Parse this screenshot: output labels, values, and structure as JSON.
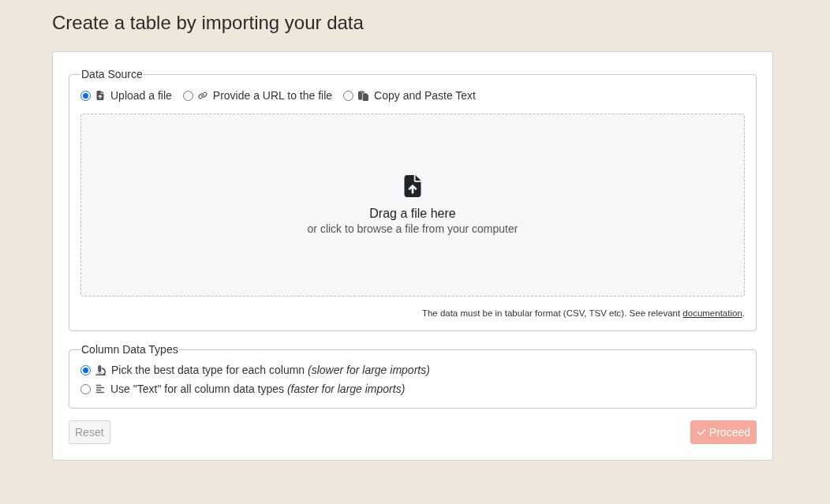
{
  "page": {
    "title": "Create a table by importing your data"
  },
  "data_source": {
    "legend": "Data Source",
    "options": [
      {
        "kind": "file",
        "label": "Upload a file",
        "selected": true
      },
      {
        "kind": "url",
        "label": "Provide a URL to the file",
        "selected": false
      },
      {
        "kind": "paste",
        "label": "Copy and Paste Text",
        "selected": false
      }
    ],
    "dropzone": {
      "title": "Drag a file here",
      "subtitle": "or click to browse a file from your computer"
    },
    "note": {
      "text": "The data must be in tabular format (CSV, TSV etc). See relevant ",
      "link": "documentation",
      "end": "."
    }
  },
  "column_types": {
    "legend": "Column Data Types",
    "options": [
      {
        "kind": "auto",
        "label": "Pick the best data type for each column *(slower for large imports)*",
        "selected": true
      },
      {
        "kind": "text",
        "label": "Use \"Text\" for all column data types *(faster for large imports)*",
        "selected": false
      }
    ]
  },
  "buttons": [
    {
      "kind": "secondary",
      "label": "Reset",
      "disabled": true
    },
    {
      "kind": "primary",
      "label": "Proceed",
      "disabled": true
    }
  ]
}
